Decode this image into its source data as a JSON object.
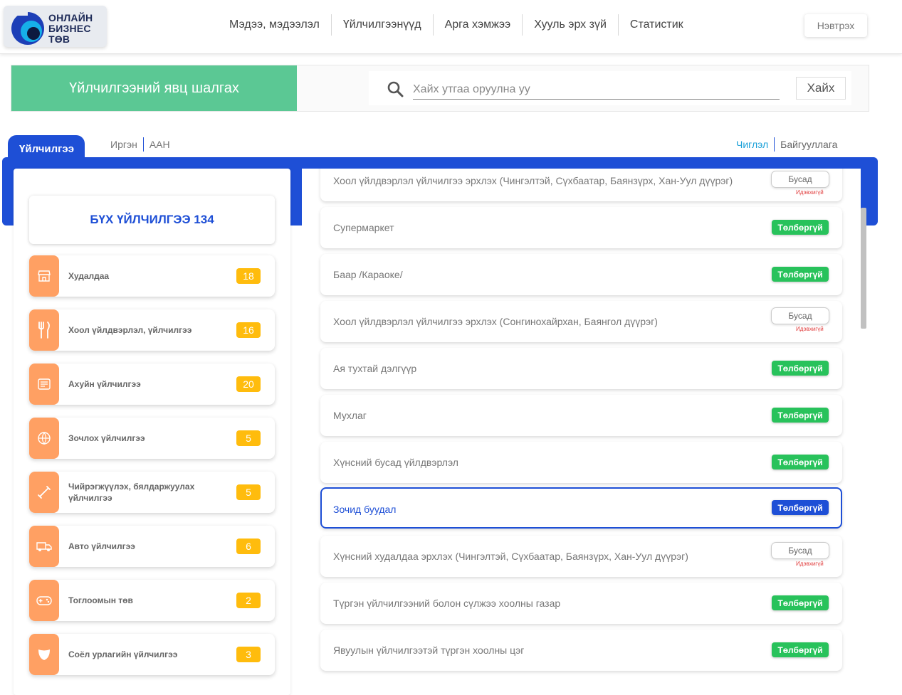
{
  "header": {
    "logo_line1": "ОНЛАЙН",
    "logo_line2": "БИЗНЕС",
    "logo_line3": "ТӨВ",
    "nav": [
      "Мэдээ, мэдээлэл",
      "Үйлчилгээнүүд",
      "Арга хэмжээ",
      "Хууль эрх зүй",
      "Статистик"
    ],
    "login_label": "Нэвтрэх"
  },
  "search": {
    "title": "Үйлчилгээний явц шалгах",
    "placeholder": "Хайх утгаа оруулна уу",
    "button_label": "Хайх"
  },
  "tabs": {
    "active": "Үйлчилгээ",
    "links": [
      "Иргэн",
      "ААН"
    ],
    "right_active": "Чиглэл",
    "right_other": "Байгууллага"
  },
  "categories": {
    "all_label": "БҮХ ҮЙЛЧИЛГЭЭ 134",
    "items": [
      {
        "label": "Худалдаа",
        "count": "18",
        "icon": "shop-icon"
      },
      {
        "label": "Хоол үйлдвэрлэл, үйлчилгээ",
        "count": "16",
        "icon": "fork-knife-icon"
      },
      {
        "label": "Ахуйн үйлчилгээ",
        "count": "20",
        "icon": "household-icon"
      },
      {
        "label": "Зочлох үйлчилгээ",
        "count": "5",
        "icon": "globe-icon"
      },
      {
        "label": "Чийрэгжүүлэх, бялдаржуулах үйлчилгээ",
        "count": "5",
        "icon": "dumbbell-icon"
      },
      {
        "label": "Авто үйлчилгээ",
        "count": "6",
        "icon": "truck-icon"
      },
      {
        "label": "Тоглоомын төв",
        "count": "2",
        "icon": "gamepad-icon"
      },
      {
        "label": "Соёл урлагийн үйлчилгээ",
        "count": "3",
        "icon": "masks-icon"
      }
    ]
  },
  "services": {
    "free_label": "Төлбөргүй",
    "other_label": "Бусад",
    "other_note": "Идэвхигүй",
    "items": [
      {
        "label": "Хоол үйлдвэрлэл үйлчилгээ эрхлэх (Чингэлтэй, Сүхбаатар, Баянзүрх, Хан-Уул дүүрэг)",
        "status": "other"
      },
      {
        "label": "Супермаркет",
        "status": "free"
      },
      {
        "label": "Баар /Караоке/",
        "status": "free"
      },
      {
        "label": "Хоол үйлдвэрлэл үйлчилгээ эрхлэх (Сонгинохайрхан, Баянгол дүүрэг)",
        "status": "other"
      },
      {
        "label": "Ая тухтай дэлгүүр",
        "status": "free"
      },
      {
        "label": "Мухлаг",
        "status": "free"
      },
      {
        "label": "Хүнсний бусад үйлдвэрлэл",
        "status": "free"
      },
      {
        "label": "Зочид буудал",
        "status": "free",
        "selected": true
      },
      {
        "label": "Хүнсний худалдаа эрхлэх (Чингэлтэй, Сүхбаатар, Баянзүрх, Хан-Уул дүүрэг)",
        "status": "other"
      },
      {
        "label": "Түргэн үйлчилгээний болон сүлжээ хоолны газар",
        "status": "free"
      },
      {
        "label": "Явуулын үйлчилгээтэй түргэн хоолны цэг",
        "status": "free"
      }
    ]
  },
  "colors": {
    "brand_blue": "#1e4fd6",
    "green": "#5bc894",
    "badge_green": "#28c25b",
    "orange": "#ffa063",
    "count_yellow": "#ffbc0d"
  }
}
